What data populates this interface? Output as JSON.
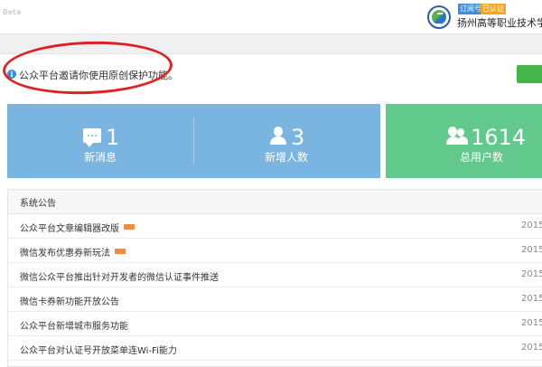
{
  "header": {
    "beta_label": "Beta",
    "subscription_tag": "订阅号",
    "verified_tag": "已认证",
    "school_name": "扬州高等职业技术学校"
  },
  "notice": {
    "text": "公众平台邀请你使用原创保护功能。",
    "icon": "info-icon",
    "annotation_color": "#e02020"
  },
  "stats": [
    {
      "icon": "message-icon",
      "value": "1",
      "label": "新消息",
      "color": "#7ab4e0"
    },
    {
      "icon": "user-icon",
      "value": "3",
      "label": "新增人数",
      "color": "#7ab4e0"
    },
    {
      "icon": "users-icon",
      "value": "1614",
      "label": "总用户数",
      "color": "#61c98b"
    }
  ],
  "announcements": {
    "title": "系统公告",
    "items": [
      {
        "title": "公众平台文章编辑器改版",
        "is_new": true,
        "date": "2015"
      },
      {
        "title": "微信发布优惠券新玩法",
        "is_new": true,
        "date": "2015"
      },
      {
        "title": "微信公众平台推出针对开发者的微信认证事件推送",
        "is_new": false,
        "date": "2015"
      },
      {
        "title": "微信卡券新功能开放公告",
        "is_new": false,
        "date": "2015"
      },
      {
        "title": "公众平台新增城市服务功能",
        "is_new": false,
        "date": "2015"
      },
      {
        "title": "公众平台对认证号开放菜单连Wi-Fi能力",
        "is_new": false,
        "date": "2015"
      }
    ]
  },
  "colors": {
    "accent_blue": "#7ab4e0",
    "accent_green": "#61c98b",
    "button_green": "#44b549",
    "badge_orange": "#f58a3c"
  }
}
